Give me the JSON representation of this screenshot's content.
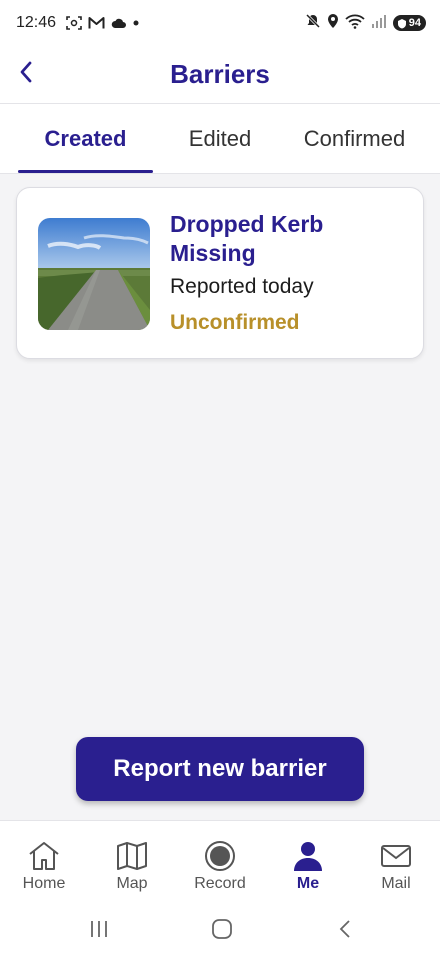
{
  "status_bar": {
    "time": "12:46",
    "battery": "94",
    "icons": [
      "screenshot-icon",
      "gmail-icon",
      "cloud-icon",
      "dot-icon",
      "mute-icon",
      "location-icon",
      "wifi-icon",
      "signal-icon",
      "battery-icon"
    ]
  },
  "header": {
    "title": "Barriers",
    "back_icon": "chevron-left-icon"
  },
  "tabs": [
    {
      "label": "Created",
      "active": true
    },
    {
      "label": "Edited",
      "active": false
    },
    {
      "label": "Confirmed",
      "active": false
    }
  ],
  "barriers": [
    {
      "title": "Dropped Kerb Missing",
      "reported": "Reported today",
      "status": "Unconfirmed",
      "status_color": "#b8902a"
    }
  ],
  "report_button": {
    "label": "Report new barrier"
  },
  "bottom_nav": [
    {
      "label": "Home",
      "icon": "home-icon",
      "active": false
    },
    {
      "label": "Map",
      "icon": "map-icon",
      "active": false
    },
    {
      "label": "Record",
      "icon": "record-icon",
      "active": false
    },
    {
      "label": "Me",
      "icon": "person-icon",
      "active": true
    },
    {
      "label": "Mail",
      "icon": "mail-icon",
      "active": false
    }
  ],
  "colors": {
    "accent": "#2a1f8f",
    "unconfirmed": "#b8902a"
  }
}
